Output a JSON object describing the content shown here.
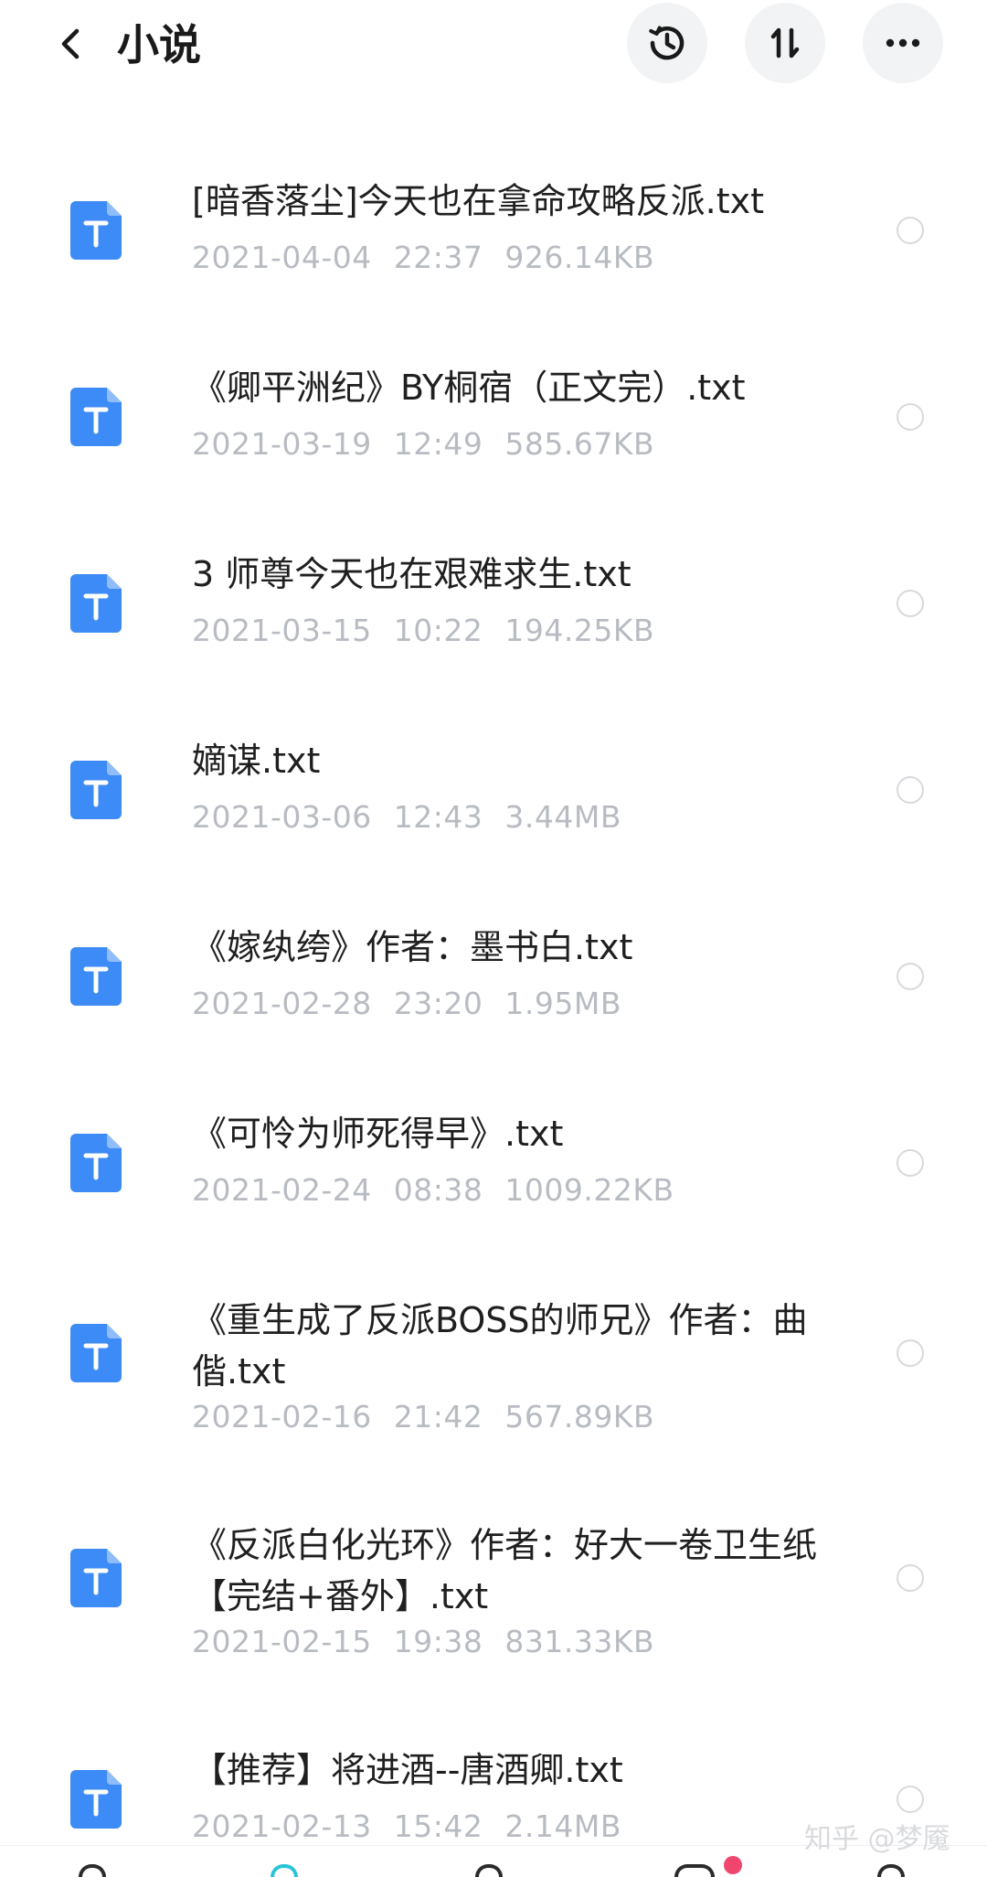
{
  "header": {
    "title": "小说",
    "back_icon": "chevron-left-icon",
    "history_icon": "history-icon",
    "sort_icon": "sort-icon",
    "more_icon": "more-horizontal-icon"
  },
  "files": [
    {
      "name": "[暗香落尘]今天也在拿命攻略反派.txt",
      "date": "2021-04-04",
      "time": "22:37",
      "size": "926.14KB"
    },
    {
      "name": "《卿平洲纪》BY桐宿（正文完）.txt",
      "date": "2021-03-19",
      "time": "12:49",
      "size": "585.67KB"
    },
    {
      "name": "3 师尊今天也在艰难求生.txt",
      "date": "2021-03-15",
      "time": "10:22",
      "size": "194.25KB"
    },
    {
      "name": "嫡谋.txt",
      "date": "2021-03-06",
      "time": "12:43",
      "size": "3.44MB"
    },
    {
      "name": "《嫁纨绔》作者：墨书白.txt",
      "date": "2021-02-28",
      "time": "23:20",
      "size": "1.95MB"
    },
    {
      "name": "《可怜为师死得早》.txt",
      "date": "2021-02-24",
      "time": "08:38",
      "size": "1009.22KB"
    },
    {
      "name": "《重生成了反派BOSS的师兄》作者：曲偕.txt",
      "date": "2021-02-16",
      "time": "21:42",
      "size": "567.89KB"
    },
    {
      "name": "《反派白化光环》作者：好大一卷卫生纸【完结+番外】.txt",
      "date": "2021-02-15",
      "time": "19:38",
      "size": "831.33KB"
    },
    {
      "name": "【推荐】将进酒--唐酒卿.txt",
      "date": "2021-02-13",
      "time": "15:42",
      "size": "2.14MB"
    }
  ],
  "watermark": "知乎 @梦魇",
  "colors": {
    "file_icon": "#3d8bf7",
    "meta_text": "#b8bcc2",
    "header_button_bg": "#f2f3f5",
    "notification_dot": "#f0466e"
  }
}
